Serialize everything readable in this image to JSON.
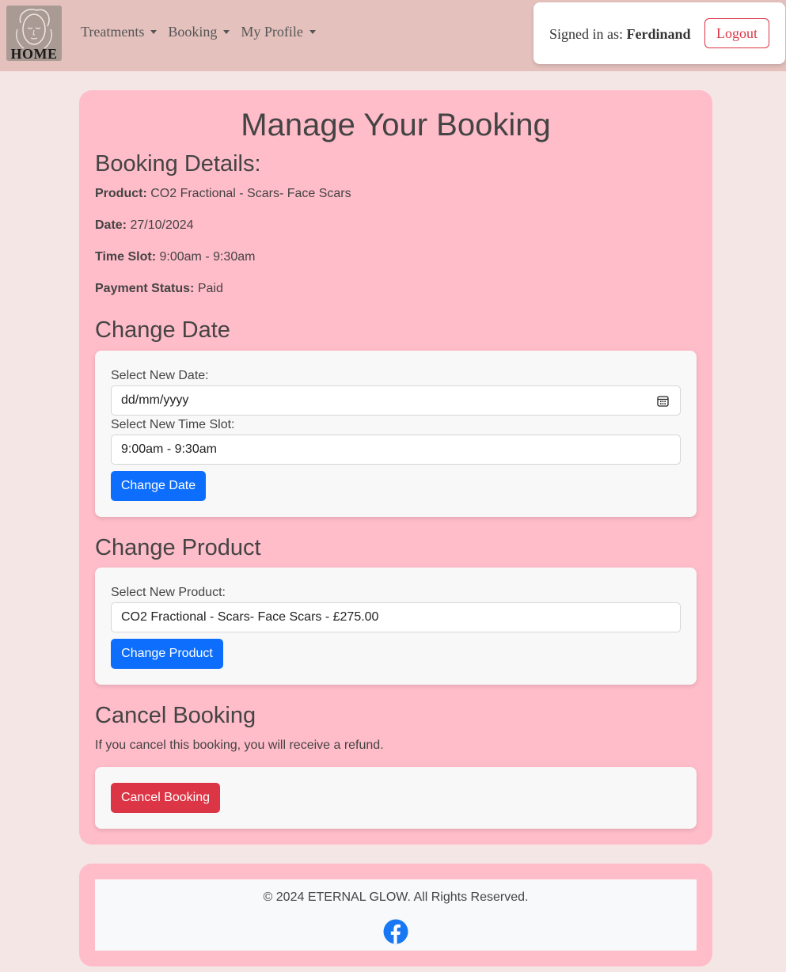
{
  "navbar": {
    "home_label": "HOME",
    "menu": [
      {
        "label": "Treatments"
      },
      {
        "label": "Booking"
      },
      {
        "label": "My Profile"
      }
    ],
    "signed_in_prefix": "Signed in as:",
    "username": "Ferdinand",
    "logout_label": "Logout"
  },
  "page": {
    "title": "Manage Your Booking"
  },
  "booking_details": {
    "heading": "Booking Details:",
    "product_label": "Product:",
    "product_value": "CO2 Fractional - Scars- Face Scars",
    "date_label": "Date:",
    "date_value": "27/10/2024",
    "time_label": "Time Slot:",
    "time_value": "9:00am - 9:30am",
    "payment_label": "Payment Status:",
    "payment_value": "Paid"
  },
  "change_date": {
    "heading": "Change Date",
    "date_label": "Select New Date:",
    "date_placeholder": "dd/mm/yyyy",
    "time_label": "Select New Time Slot:",
    "time_selected": "9:00am - 9:30am",
    "button_label": "Change Date"
  },
  "change_product": {
    "heading": "Change Product",
    "product_label": "Select New Product:",
    "product_selected": "CO2 Fractional - Scars- Face Scars - £275.00",
    "button_label": "Change Product"
  },
  "cancel_booking": {
    "heading": "Cancel Booking",
    "note": "If you cancel this booking, you will receive a refund.",
    "button_label": "Cancel Booking"
  },
  "footer": {
    "copyright": "© 2024 ETERNAL GLOW. All Rights Reserved."
  },
  "colors": {
    "navbar_bg": "#e4c1bd",
    "page_bg": "#f5e6e6",
    "card_bg": "#ffbcc9",
    "primary": "#0d6efd",
    "danger": "#dc3545",
    "facebook": "#1877f2"
  },
  "icons": [
    "face-logo-icon",
    "caret-down-icon",
    "calendar-icon",
    "facebook-icon"
  ]
}
